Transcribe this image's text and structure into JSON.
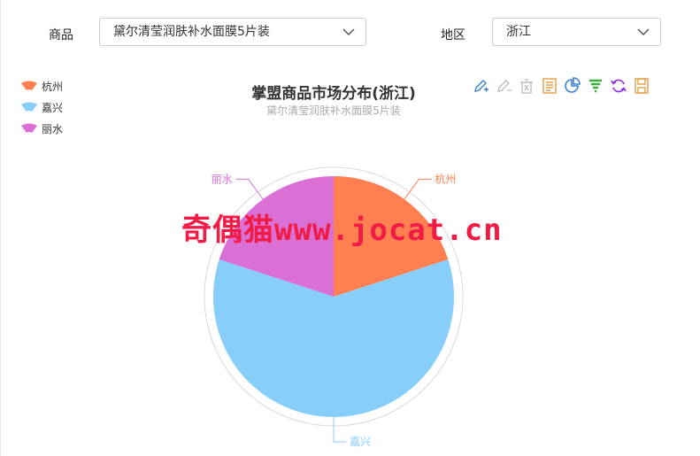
{
  "filters": {
    "product": {
      "label": "商品",
      "value": "黛尔清莹润肤补水面膜5片装"
    },
    "region": {
      "label": "地区",
      "value": "浙江"
    }
  },
  "watermark": {
    "cn": "奇偶猫",
    "url": "www.jocat.cn"
  },
  "toolbox": [
    {
      "name": "mark-icon",
      "color": "#3b82d6"
    },
    {
      "name": "mark-undo-icon",
      "color": "#c0c0c0"
    },
    {
      "name": "mark-clear-icon",
      "color": "#c0c0c0"
    },
    {
      "name": "data-view-icon",
      "color": "#e3a048"
    },
    {
      "name": "pie-chart-icon",
      "color": "#3b82d6"
    },
    {
      "name": "funnel-icon",
      "color": "#3dae3d"
    },
    {
      "name": "restore-icon",
      "color": "#8a2be2"
    },
    {
      "name": "save-image-icon",
      "color": "#e3a048"
    }
  ],
  "chart_data": {
    "type": "pie",
    "title": "掌盟商品市场分布(浙江)",
    "subtitle": "黛尔清莹润肤补水面膜5片装",
    "legend_position": "top-left",
    "series": [
      {
        "name": "杭州",
        "value": 20,
        "color": "#ff7f50"
      },
      {
        "name": "嘉兴",
        "value": 60,
        "color": "#87cefa"
      },
      {
        "name": "丽水",
        "value": 20,
        "color": "#da70d6"
      }
    ]
  }
}
